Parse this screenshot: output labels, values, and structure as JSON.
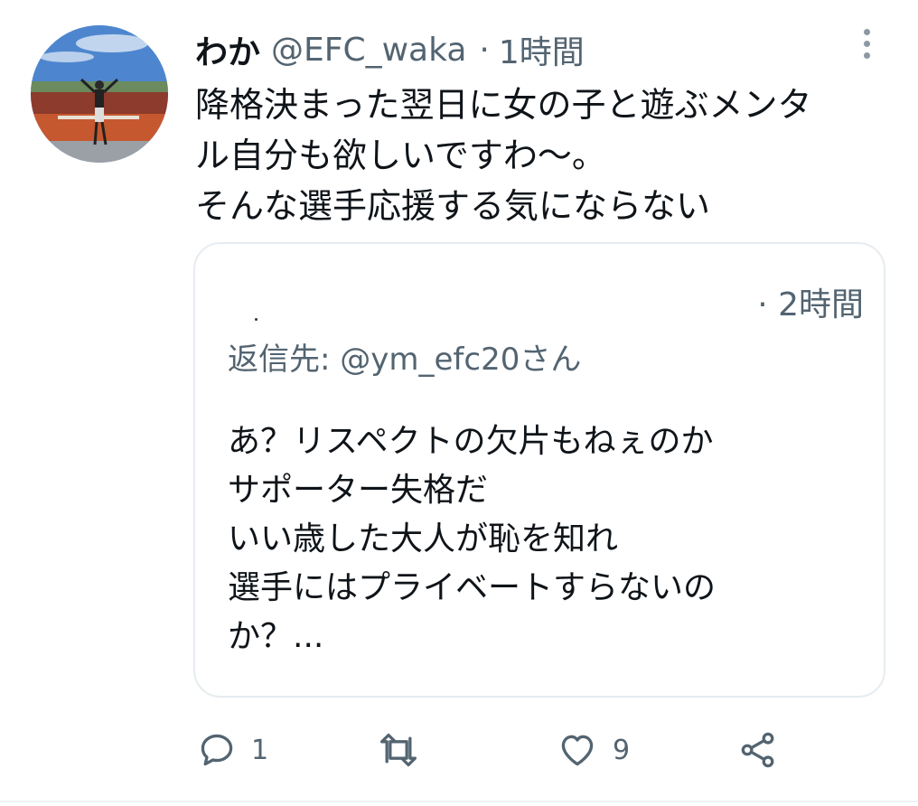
{
  "tweet": {
    "display_name": "わか",
    "handle": "@EFC_waka",
    "separator": "·",
    "time": "1時間",
    "text_lines": [
      "降格決まった翌日に女の子と遊ぶメンタ",
      "ル自分も欲しいですわ〜。",
      "そんな選手応援する気にならない"
    ]
  },
  "quote": {
    "time": "· 2時間",
    "reply_to": "返信先: @ym_efc20さん",
    "text_lines": [
      "あ？リスペクトの欠片もねぇのか",
      "サポーター失格だ",
      "いい歳した大人が恥を知れ",
      "選手にはプライベートすらないの",
      "か？..."
    ]
  },
  "actions": {
    "reply_count": "1",
    "retweet_count": "",
    "like_count": "9"
  },
  "icons": {
    "reply": "reply-icon",
    "retweet": "retweet-icon",
    "like": "like-icon",
    "share": "share-icon",
    "more": "more-icon"
  },
  "colors": {
    "text": "#0f1419",
    "secondary": "#536471",
    "border": "#e6ecf0"
  }
}
